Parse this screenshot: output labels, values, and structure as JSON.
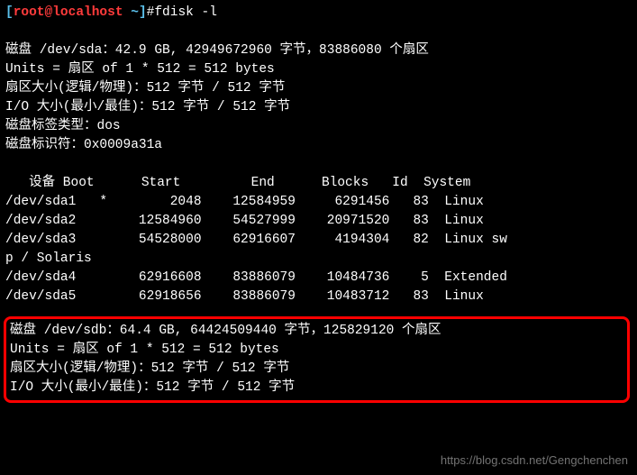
{
  "prompt": {
    "open": "[",
    "user": "root@localhost",
    "space": " ",
    "path": "~",
    "close": "]",
    "hash": "#",
    "command": "fdisk -l"
  },
  "disk_sda": {
    "line1": "磁盘 /dev/sda：42.9 GB, 42949672960 字节，83886080 个扇区",
    "line2": "Units = 扇区 of 1 * 512 = 512 bytes",
    "line3": "扇区大小(逻辑/物理)：512 字节 / 512 字节",
    "line4": "I/O 大小(最小/最佳)：512 字节 / 512 字节",
    "line5": "磁盘标签类型：dos",
    "line6": "磁盘标识符：0x0009a31a"
  },
  "partition_table": {
    "header": "   设备 Boot      Start         End      Blocks   Id  System",
    "rows": [
      "/dev/sda1   *        2048    12584959     6291456   83  Linux",
      "/dev/sda2        12584960    54527999    20971520   83  Linux",
      "/dev/sda3        54528000    62916607     4194304   82  Linux sw",
      "p / Solaris",
      "/dev/sda4        62916608    83886079    10484736    5  Extended",
      "/dev/sda5        62918656    83886079    10483712   83  Linux"
    ]
  },
  "disk_sdb": {
    "line1": "磁盘 /dev/sdb：64.4 GB, 64424509440 字节，125829120 个扇区",
    "line2": "Units = 扇区 of 1 * 512 = 512 bytes",
    "line3": "扇区大小(逻辑/物理)：512 字节 / 512 字节",
    "line4": "I/O 大小(最小/最佳)：512 字节 / 512 字节"
  },
  "watermark": "https://blog.csdn.net/Gengchenchen"
}
